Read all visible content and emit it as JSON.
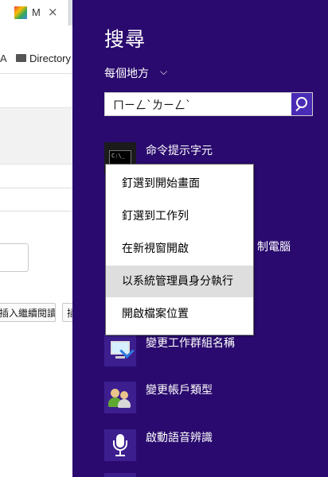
{
  "browser": {
    "tab_title": "M",
    "tab_close": "×",
    "bookmark_prefix": "A",
    "bookmark_label": "Directory",
    "read_button_label": "插入繼續閱讀",
    "second_button_label": "插"
  },
  "charm": {
    "title": "搜尋",
    "scope": "每個地方",
    "scope_chevron": "⌵",
    "query": "ㄇㄧㄥˋㄌㄧㄥˋ",
    "results": [
      {
        "label": "命令提示字元",
        "icon": "cmd-icon"
      },
      {
        "label": "制電腦",
        "icon": "control-icon"
      },
      {
        "label": "變更工作群組名稱",
        "icon": "monitor-icon"
      },
      {
        "label": "變更帳戶類型",
        "icon": "users-icon"
      },
      {
        "label": "啟動語音辨識",
        "icon": "microphone-icon"
      }
    ]
  },
  "context_menu": {
    "items": [
      {
        "label": "釘選到開始畫面"
      },
      {
        "label": "釘選到工作列"
      },
      {
        "label": "在新視窗開啟"
      },
      {
        "label": "以系統管理員身分執行",
        "highlighted": true
      },
      {
        "label": "開啟檔案位置"
      }
    ]
  },
  "colors": {
    "charm_background": "#2a0a6e",
    "search_button": "#4a2bb5",
    "menu_highlight": "#dedede"
  }
}
